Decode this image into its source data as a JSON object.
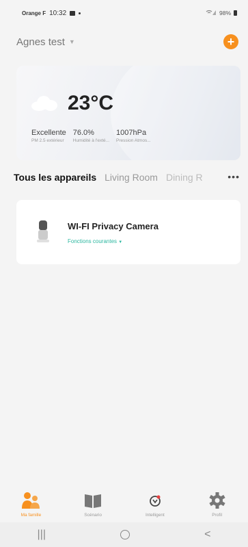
{
  "status_bar": {
    "carrier": "Orange F",
    "time": "10:32",
    "battery": "98%"
  },
  "header": {
    "home_name": "Agnes test",
    "add_icon": "plus-icon"
  },
  "weather": {
    "temperature": "23°C",
    "stats": [
      {
        "value": "Excellente",
        "label": "PM 2.5 extérieur"
      },
      {
        "value": "76.0%",
        "label": "Humidité à l'exté..."
      },
      {
        "value": "1007hPa",
        "label": "Pression Atmos..."
      }
    ]
  },
  "tabs": [
    {
      "label": "Tous les appareils"
    },
    {
      "label": "Living Room"
    },
    {
      "label": "Dining R"
    }
  ],
  "device": {
    "name": "WI-FI Privacy Camera",
    "function_label": "Fonctions courantes"
  },
  "bottom_nav": [
    {
      "label": "Ma famille",
      "icon": "family-icon"
    },
    {
      "label": "Scénario",
      "icon": "book-icon"
    },
    {
      "label": "Intelligent",
      "icon": "smart-icon"
    },
    {
      "label": "Profil",
      "icon": "gear-icon"
    }
  ],
  "colors": {
    "accent": "#f7901e",
    "teal": "#2cb7a0"
  }
}
